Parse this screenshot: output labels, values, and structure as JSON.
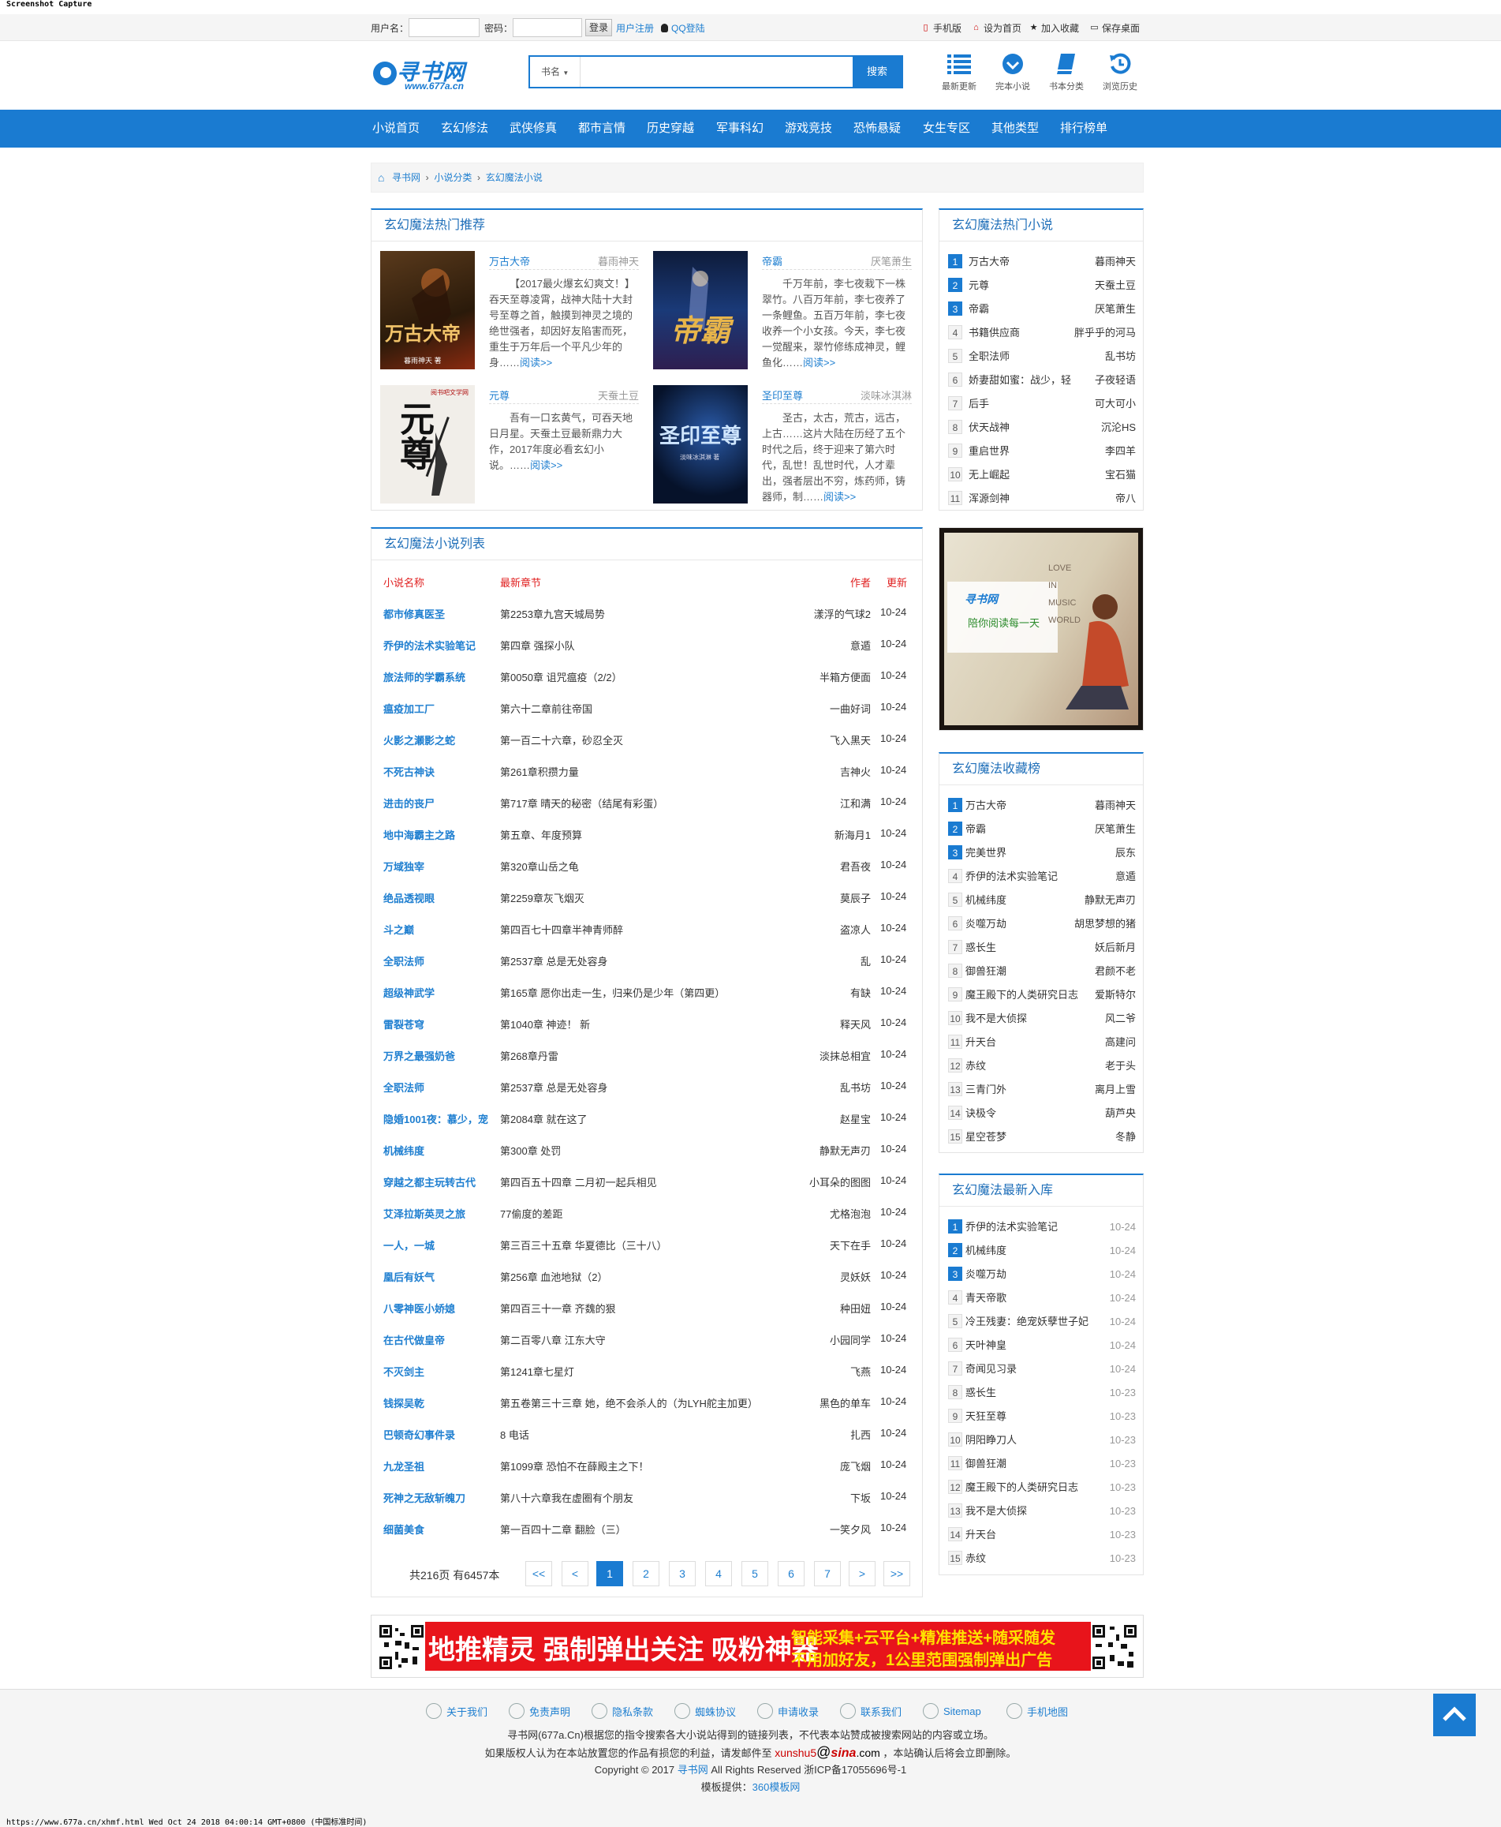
{
  "capture_title": "Screenshot Capture",
  "status_line": "https://www.677a.cn/xhmf.html Wed Oct 24 2018 04:00:14 GMT+0800 (中国标准时间)",
  "topbar": {
    "username_label": "用户名：",
    "password_label": "密码：",
    "login_button": "登录",
    "register_link": "用户注册",
    "qq_login": "QQ登陆",
    "right_links": [
      "手机版",
      "设为首页",
      "加入收藏",
      "保存桌面"
    ]
  },
  "logo": {
    "title": "寻书网",
    "url": "www.677a.cn"
  },
  "search": {
    "select_label": "书名",
    "placeholder": "",
    "button": "搜索"
  },
  "quick_nav": [
    {
      "label": "最新更新",
      "icon": "list-icon"
    },
    {
      "label": "完本小说",
      "icon": "check-circle-icon"
    },
    {
      "label": "书本分类",
      "icon": "book-icon"
    },
    {
      "label": "浏览历史",
      "icon": "history-icon"
    }
  ],
  "nav": [
    "小说首页",
    "玄幻修法",
    "武侠修真",
    "都市言情",
    "历史穿越",
    "军事科幻",
    "游戏竞技",
    "恐怖悬疑",
    "女生专区",
    "其他类型",
    "排行榜单"
  ],
  "breadcrumb": [
    "寻书网",
    "小说分类",
    "玄幻魔法小说"
  ],
  "hot_recommend": {
    "title": "玄幻魔法热门推荐",
    "books": [
      {
        "title": "万古大帝",
        "author": "暮雨神天",
        "desc": "【2017最火爆玄幻爽文！】吞天至尊凌霄，战神大陆十大封号至尊之首，触摸到神灵之境的绝世强者，却因好友陷害而死，重生于万年后一个平凡少年的身……",
        "more": "阅读>>",
        "cover_text": "万古大帝",
        "cover_sub": "暮雨神天 著"
      },
      {
        "title": "帝霸",
        "author": "厌笔萧生",
        "desc": "千万年前，李七夜栽下一株翠竹。八百万年前，李七夜养了一条鲤鱼。五百万年前，李七夜收养一个小女孩。今天，李七夜一觉醒来，翠竹修练成神灵，鲤鱼化……",
        "more": "阅读>>",
        "cover_text": "帝霸",
        "cover_sub": ""
      },
      {
        "title": "元尊",
        "author": "天蚕土豆",
        "desc": "吾有一口玄黄气，可吞天地日月星。天蚕土豆最新鼎力大作，2017年度必看玄幻小说。……",
        "more": "阅读>>",
        "cover_text": "元尊",
        "cover_sub": "阅书吧文学网"
      },
      {
        "title": "圣印至尊",
        "author": "淡味冰淇淋",
        "desc": "圣古，太古，荒古，远古，上古……这片大陆在历经了五个时代之后，终于迎来了第六时代，乱世！乱世时代，人才辈出，强者层出不穷，炼药师，铸器师，制……",
        "more": "阅读>>",
        "cover_text": "圣印至尊",
        "cover_sub": "淡味冰淇淋 著"
      }
    ]
  },
  "hot_novels": {
    "title": "玄幻魔法热门小说",
    "items": [
      {
        "n": "1",
        "name": "万古大帝",
        "author": "暮雨神天"
      },
      {
        "n": "2",
        "name": "元尊",
        "author": "天蚕土豆"
      },
      {
        "n": "3",
        "name": "帝霸",
        "author": "厌笔萧生"
      },
      {
        "n": "4",
        "name": "书籍供应商",
        "author": "胖乎乎的河马"
      },
      {
        "n": "5",
        "name": "全职法师",
        "author": "乱书坊"
      },
      {
        "n": "6",
        "name": "娇妻甜如蜜：战少，轻",
        "author": "子夜轻语"
      },
      {
        "n": "7",
        "name": "后手",
        "author": "可大可小"
      },
      {
        "n": "8",
        "name": "伏天战神",
        "author": "沉沦HS"
      },
      {
        "n": "9",
        "name": "重启世界",
        "author": "李四羊"
      },
      {
        "n": "10",
        "name": "无上崛起",
        "author": "宝石猫"
      },
      {
        "n": "11",
        "name": "浑源剑神",
        "author": "帝八"
      }
    ]
  },
  "novel_list": {
    "title": "玄幻魔法小说列表",
    "headers": {
      "name": "小说名称",
      "chapter": "最新章节",
      "author": "作者",
      "date": "更新"
    },
    "rows": [
      {
        "name": "都市修真医圣",
        "chapter": "第2253章九宫天城局势",
        "author": "漾浮的气球2",
        "date": "10-24"
      },
      {
        "name": "乔伊的法术实验笔记",
        "chapter": "第四章 强探小队",
        "author": "意遁",
        "date": "10-24"
      },
      {
        "name": "旅法师的学霸系统",
        "chapter": "第0050章 诅咒瘟疫（2/2）",
        "author": "半箱方便面",
        "date": "10-24"
      },
      {
        "name": "瘟疫加工厂",
        "chapter": "第六十二章前往帝国",
        "author": "一曲好词",
        "date": "10-24"
      },
      {
        "name": "火影之瀬影之蛇",
        "chapter": "第一百二十六章，砂忍全灭",
        "author": "飞入黑天",
        "date": "10-24"
      },
      {
        "name": "不死古神诀",
        "chapter": "第261章积攒力量",
        "author": "吉神火",
        "date": "10-24"
      },
      {
        "name": "进击的丧尸",
        "chapter": "第717章 晴天的秘密（结尾有彩蛋）",
        "author": "江和满",
        "date": "10-24"
      },
      {
        "name": "地中海霸主之路",
        "chapter": "第五章、年度预算",
        "author": "新海月1",
        "date": "10-24"
      },
      {
        "name": "万域独宰",
        "chapter": "第320章山岳之龟",
        "author": "君吾夜",
        "date": "10-24"
      },
      {
        "name": "绝品透视眼",
        "chapter": "第2259章灰飞烟灭",
        "author": "莫辰子",
        "date": "10-24"
      },
      {
        "name": "斗之巅",
        "chapter": "第四百七十四章半神青师醉",
        "author": "盗凉人",
        "date": "10-24"
      },
      {
        "name": "全职法师",
        "chapter": "第2537章 总是无处容身",
        "author": "乱",
        "date": "10-24"
      },
      {
        "name": "超级神武学",
        "chapter": "第165章 愿你出走一生，归来仍是少年（第四更）",
        "author": "有缺",
        "date": "10-24"
      },
      {
        "name": "雷裂苍穹",
        "chapter": "第1040章 神迹！ 新",
        "author": "释天风",
        "date": "10-24"
      },
      {
        "name": "万界之最强奶爸",
        "chapter": "第268章丹雷",
        "author": "淡抹总相宜",
        "date": "10-24"
      },
      {
        "name": "全职法师",
        "chapter": "第2537章 总是无处容身",
        "author": "乱书坊",
        "date": "10-24"
      },
      {
        "name": "隐婚1001夜：慕少，宠",
        "chapter": "第2084章 就在这了",
        "author": "赵星宝",
        "date": "10-24"
      },
      {
        "name": "机械纬度",
        "chapter": "第300章 处罚",
        "author": "静默无声刃",
        "date": "10-24"
      },
      {
        "name": "穿越之都主玩转古代",
        "chapter": "第四百五十四章 二月初一起兵相见",
        "author": "小耳朵的图图",
        "date": "10-24"
      },
      {
        "name": "艾泽拉斯英灵之旅",
        "chapter": "77偷度的差距",
        "author": "尤格泡泡",
        "date": "10-24"
      },
      {
        "name": "一人，一城",
        "chapter": "第三百三十五章 华夏德比（三十八）",
        "author": "天下在手",
        "date": "10-24"
      },
      {
        "name": "凰后有妖气",
        "chapter": "第256章 血池地狱（2）",
        "author": "灵妖妖",
        "date": "10-24"
      },
      {
        "name": "八零神医小娇媳",
        "chapter": "第四百三十一章 齐魏的狠",
        "author": "种田妞",
        "date": "10-24"
      },
      {
        "name": "在古代做皇帝",
        "chapter": "第二百零八章 江东大守",
        "author": "小园同学",
        "date": "10-24"
      },
      {
        "name": "不灭剑主",
        "chapter": "第1241章七星灯",
        "author": "飞燕",
        "date": "10-24"
      },
      {
        "name": "钱探吴乾",
        "chapter": "第五卷第三十三章 她，绝不会杀人的（为LYH舵主加更）",
        "author": "黑色的单车",
        "date": "10-24"
      },
      {
        "name": "巴顿奇幻事件录",
        "chapter": "8 电话",
        "author": "扎西",
        "date": "10-24"
      },
      {
        "name": "九龙圣祖",
        "chapter": "第1099章 恐怕不在薛殿主之下！",
        "author": "庞飞烟",
        "date": "10-24"
      },
      {
        "name": "死神之无敌斩魄刀",
        "chapter": "第八十六章我在虚圈有个朋友",
        "author": "下坂",
        "date": "10-24"
      },
      {
        "name": "细菌美食",
        "chapter": "第一百四十二章 翻脸（三）",
        "author": "一笑夕风",
        "date": "10-24"
      }
    ],
    "pagination": {
      "summary": "共216页 有6457本",
      "pages": [
        "<<",
        "<",
        "1",
        "2",
        "3",
        "4",
        "5",
        "6",
        "7",
        ">",
        ">>"
      ],
      "current": "1"
    }
  },
  "side_ad": {
    "logo_text": "寻书网",
    "slogan": "陪你阅读每一天",
    "deco": "LOVE IN MUSIC WORLD"
  },
  "collect_rank": {
    "title": "玄幻魔法收藏榜",
    "items": [
      {
        "n": "1",
        "name": "万古大帝",
        "author": "暮雨神天"
      },
      {
        "n": "2",
        "name": "帝霸",
        "author": "厌笔萧生"
      },
      {
        "n": "3",
        "name": "完美世界",
        "author": "辰东"
      },
      {
        "n": "4",
        "name": "乔伊的法术实验笔记",
        "author": "意遁"
      },
      {
        "n": "5",
        "name": "机械纬度",
        "author": "静默无声刃"
      },
      {
        "n": "6",
        "name": "炎噬万劫",
        "author": "胡思梦想的猪"
      },
      {
        "n": "7",
        "name": "惑长生",
        "author": "妖后新月"
      },
      {
        "n": "8",
        "name": "御兽狂潮",
        "author": "君颜不老"
      },
      {
        "n": "9",
        "name": "魔王殿下的人类研究日志",
        "author": "爱斯特尔"
      },
      {
        "n": "10",
        "name": "我不是大侦探",
        "author": "风二爷"
      },
      {
        "n": "11",
        "name": "升天台",
        "author": "高建问"
      },
      {
        "n": "12",
        "name": "赤纹",
        "author": "老于头"
      },
      {
        "n": "13",
        "name": "三青门外",
        "author": "离月上雪"
      },
      {
        "n": "14",
        "name": "诀极令",
        "author": "葫芦央"
      },
      {
        "n": "15",
        "name": "星空苍梦",
        "author": "冬静"
      }
    ]
  },
  "newest": {
    "title": "玄幻魔法最新入库",
    "items": [
      {
        "n": "1",
        "name": "乔伊的法术实验笔记",
        "date": "10-24"
      },
      {
        "n": "2",
        "name": "机械纬度",
        "date": "10-24"
      },
      {
        "n": "3",
        "name": "炎噬万劫",
        "date": "10-24"
      },
      {
        "n": "4",
        "name": "青天帝歌",
        "date": "10-24"
      },
      {
        "n": "5",
        "name": "冷王残妻：绝宠妖孽世子妃",
        "date": "10-24"
      },
      {
        "n": "6",
        "name": "天叶神皇",
        "date": "10-24"
      },
      {
        "n": "7",
        "name": "奇闻见习录",
        "date": "10-24"
      },
      {
        "n": "8",
        "name": "惑长生",
        "date": "10-23"
      },
      {
        "n": "9",
        "name": "天狂至尊",
        "date": "10-23"
      },
      {
        "n": "10",
        "name": "阴阳睁刀人",
        "date": "10-23"
      },
      {
        "n": "11",
        "name": "御兽狂潮",
        "date": "10-23"
      },
      {
        "n": "12",
        "name": "魔王殿下的人类研究日志",
        "date": "10-23"
      },
      {
        "n": "13",
        "name": "我不是大侦探",
        "date": "10-23"
      },
      {
        "n": "14",
        "name": "升天台",
        "date": "10-23"
      },
      {
        "n": "15",
        "name": "赤纹",
        "date": "10-23"
      }
    ]
  },
  "banner": {
    "main": "地推精灵 强制弹出关注 吸粉神器",
    "line1": "智能采集+云平台+精准推送+随采随发",
    "line2": "不用加好友，1公里范围强制弹出广告"
  },
  "footer": {
    "links": [
      "关于我们",
      "免责声明",
      "隐私条款",
      "蜘蛛协议",
      "申请收录",
      "联系我们",
      "Sitemap",
      "手机地图"
    ],
    "line1": "寻书网(677a.Cn)根据您的指令搜索各大小说站得到的链接列表，不代表本站赞成被搜索网站的内容或立场。",
    "line2_a": "如果版权人认为在本站放置您的作品有损您的利益，请发邮件至",
    "email_user": "xunshu5",
    "email_at": "@",
    "email_domain_brand": "sina",
    "email_tld": ".com",
    "line2_b": "，本站确认后将会立即删除。",
    "copyright_a": "Copyright © 2017",
    "copyright_link": "寻书网",
    "copyright_b": "All Rights Reserved 浙ICP备17055696号-1",
    "template_a": "模板提供：",
    "template_link": "360模板网"
  },
  "colors": {
    "brand": "#1a7bd1",
    "accent_red": "#e02020",
    "footer_bg": "#f5f5f5"
  }
}
